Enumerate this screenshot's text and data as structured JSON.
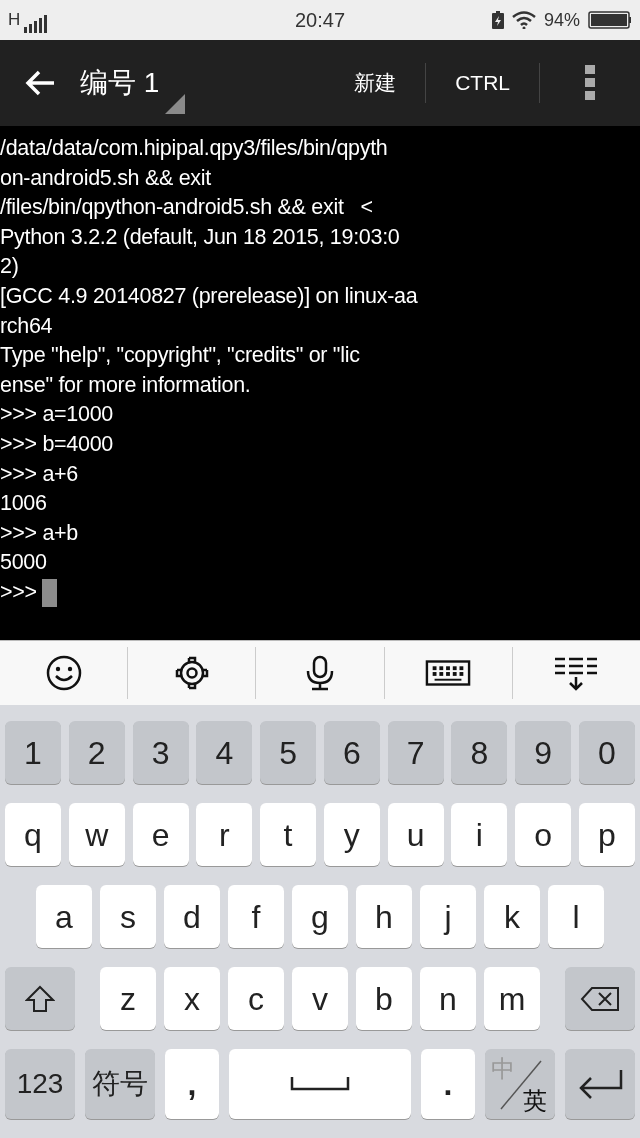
{
  "status_bar": {
    "network": "H",
    "time": "20:47",
    "battery": "94%"
  },
  "toolbar": {
    "title": "编号 1",
    "actions": [
      {
        "label": "新建"
      },
      {
        "label": "CTRL"
      }
    ]
  },
  "terminal": {
    "lines": [
      "/data/data/com.hipipal.qpy3/files/bin/qpyth",
      "on-android5.sh && exit",
      "/files/bin/qpython-android5.sh && exit   <",
      "Python 3.2.2 (default, Jun 18 2015, 19:03:0",
      "2)",
      "[GCC 4.9 20140827 (prerelease)] on linux-aa",
      "rch64",
      "Type \"help\", \"copyright\", \"credits\" or \"lic",
      "ense\" for more information.",
      ">>> a=1000",
      ">>> b=4000",
      ">>> a+6",
      "1006",
      ">>> a+b",
      "5000",
      ">>> "
    ],
    "cursor": true
  },
  "keyboard": {
    "rows": [
      {
        "keys": [
          {
            "kind": "digit",
            "label": "1"
          },
          {
            "kind": "digit",
            "label": "2"
          },
          {
            "kind": "digit",
            "label": "3"
          },
          {
            "kind": "digit",
            "label": "4"
          },
          {
            "kind": "digit",
            "label": "5"
          },
          {
            "kind": "digit",
            "label": "6"
          },
          {
            "kind": "digit",
            "label": "7"
          },
          {
            "kind": "digit",
            "label": "8"
          },
          {
            "kind": "digit",
            "label": "9"
          },
          {
            "kind": "digit",
            "label": "0"
          }
        ]
      },
      {
        "keys": [
          {
            "kind": "char",
            "label": "q"
          },
          {
            "kind": "char",
            "label": "w"
          },
          {
            "kind": "char",
            "label": "e"
          },
          {
            "kind": "char",
            "label": "r"
          },
          {
            "kind": "char",
            "label": "t"
          },
          {
            "kind": "char",
            "label": "y"
          },
          {
            "kind": "char",
            "label": "u"
          },
          {
            "kind": "char",
            "label": "i"
          },
          {
            "kind": "char",
            "label": "o"
          },
          {
            "kind": "char",
            "label": "p"
          }
        ]
      },
      {
        "keys": [
          {
            "kind": "char",
            "label": "a"
          },
          {
            "kind": "char",
            "label": "s"
          },
          {
            "kind": "char",
            "label": "d"
          },
          {
            "kind": "char",
            "label": "f"
          },
          {
            "kind": "char",
            "label": "g"
          },
          {
            "kind": "char",
            "label": "h"
          },
          {
            "kind": "char",
            "label": "j"
          },
          {
            "kind": "char",
            "label": "k"
          },
          {
            "kind": "char",
            "label": "l"
          }
        ]
      },
      {
        "keys": [
          {
            "kind": "shift"
          },
          {
            "kind": "char",
            "label": "z"
          },
          {
            "kind": "char",
            "label": "x"
          },
          {
            "kind": "char",
            "label": "c"
          },
          {
            "kind": "char",
            "label": "v"
          },
          {
            "kind": "char",
            "label": "b"
          },
          {
            "kind": "char",
            "label": "n"
          },
          {
            "kind": "char",
            "label": "m"
          },
          {
            "kind": "backspace"
          }
        ]
      },
      {
        "keys": [
          {
            "kind": "function",
            "label": "123"
          },
          {
            "kind": "function",
            "label": "符号"
          },
          {
            "kind": "punct",
            "label": ","
          },
          {
            "kind": "space"
          },
          {
            "kind": "punct",
            "label": "."
          },
          {
            "kind": "lang",
            "options": [
              {
                "label": "中",
                "selected": false
              },
              {
                "label": "英",
                "selected": true
              }
            ]
          },
          {
            "kind": "enter"
          }
        ]
      }
    ]
  }
}
